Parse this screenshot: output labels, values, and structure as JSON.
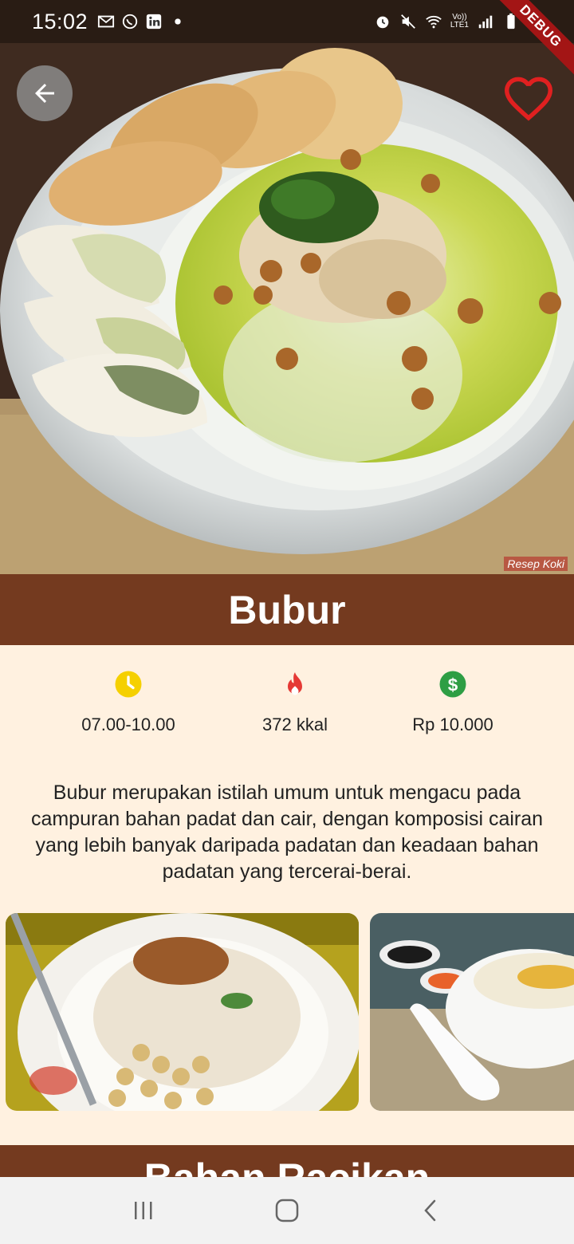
{
  "status_bar": {
    "time": "15:02",
    "left_icons": [
      "gmail-icon",
      "whatsapp-icon",
      "linkedin-icon",
      "dot-icon"
    ],
    "right_icons": [
      "alarm-icon",
      "mute-icon",
      "wifi-icon",
      "lte-signal-icon",
      "battery-icon"
    ],
    "network_label_1": "Vo))",
    "network_label_2": "LTE1"
  },
  "debug_banner": "DEBUG",
  "hero": {
    "image": "bubur-bowl-photo",
    "watermark": "Resep Koki"
  },
  "header_actions": {
    "back": "back-arrow-icon",
    "favorite": "heart-outline-icon"
  },
  "title": "Bubur",
  "info": [
    {
      "icon": "clock-icon",
      "color": "#f5d000",
      "label": "07.00-10.00"
    },
    {
      "icon": "fire-icon",
      "color": "#e53935",
      "label": "372 kkal"
    },
    {
      "icon": "dollar-icon",
      "color": "#2e9e44",
      "label": "Rp 10.000"
    }
  ],
  "description": "Bubur merupakan istilah umum untuk mengacu pada campuran bahan padat dan cair, dengan komposisi cairan yang lebih banyak daripada padatan dan keadaan bahan padatan yang tercerai-berai.",
  "gallery": [
    "bubur-with-soybeans-photo",
    "bubur-with-spoon-photo"
  ],
  "section_title": "Bahan Racikan",
  "nav": [
    "recents-icon",
    "home-icon",
    "back-icon"
  ],
  "colors": {
    "primary": "#743a1f",
    "background": "#fff1e0",
    "nav_bar": "#f2f2f2"
  }
}
